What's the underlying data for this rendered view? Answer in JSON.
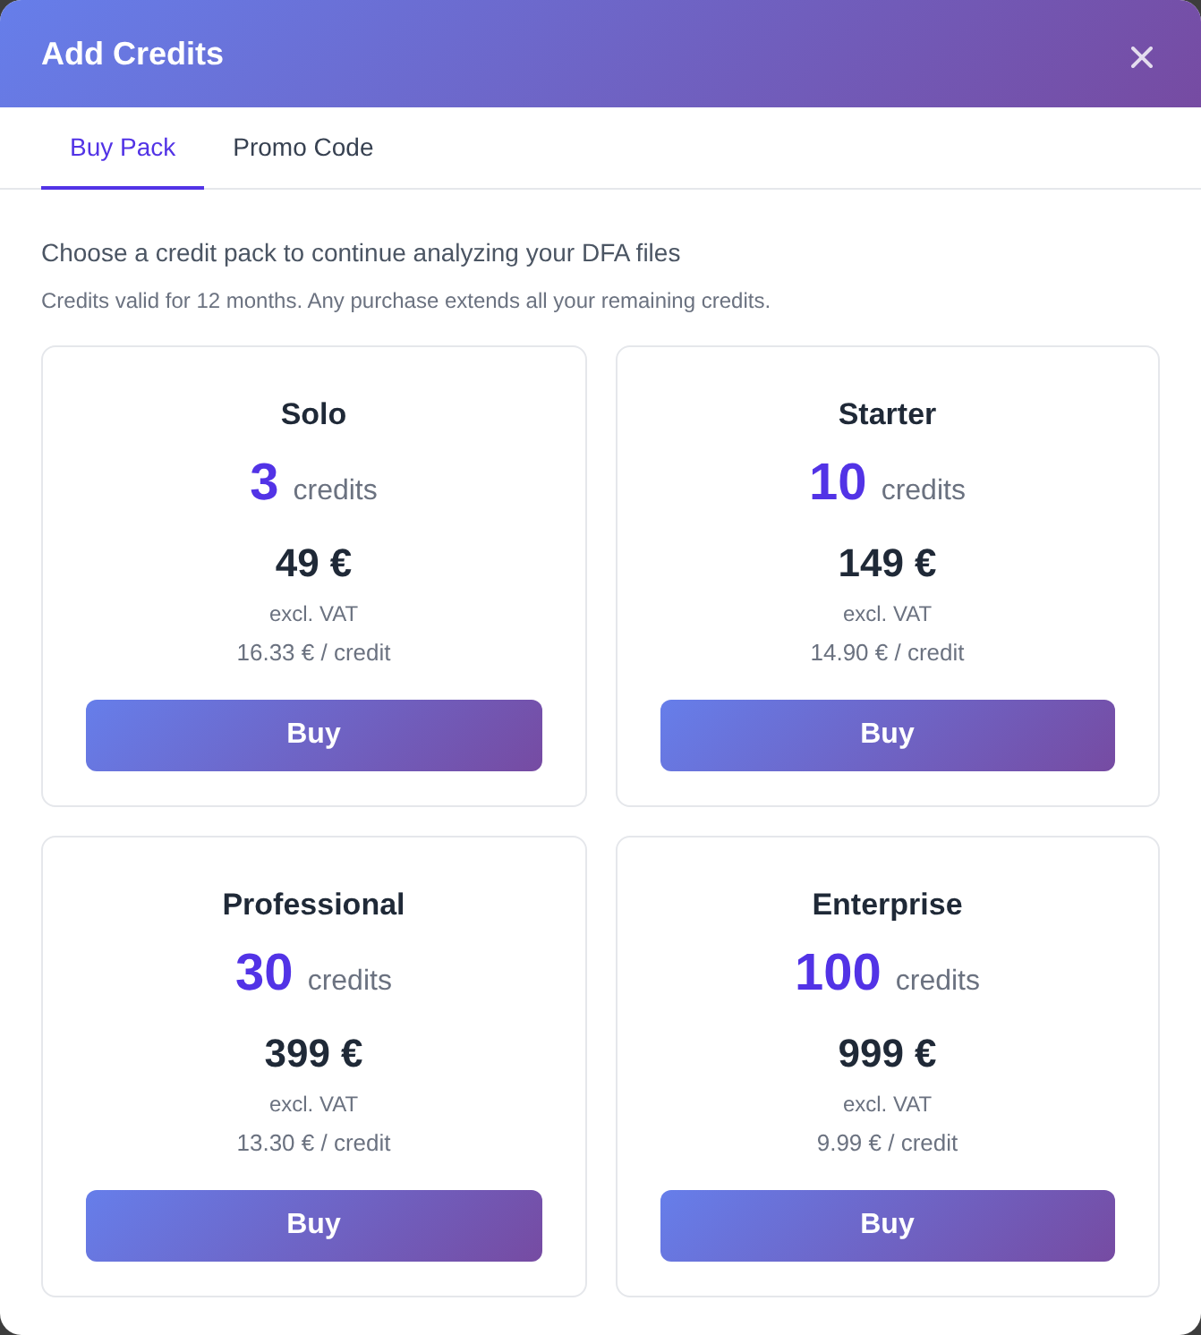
{
  "dialog": {
    "title": "Add Credits"
  },
  "tabs": [
    {
      "label": "Buy Pack",
      "selected": true
    },
    {
      "label": "Promo Code",
      "selected": false
    }
  ],
  "intro": {
    "heading": "Choose a credit pack to continue analyzing your DFA files",
    "note": "Credits valid for 12 months. Any purchase extends all your remaining credits."
  },
  "packs": [
    {
      "name": "Solo",
      "credits": "3",
      "credits_unit": "credits",
      "price": "49 €",
      "tax_note": "excl. VAT",
      "unit_price": "16.33 € / credit",
      "button": "Buy"
    },
    {
      "name": "Starter",
      "credits": "10",
      "credits_unit": "credits",
      "price": "149 €",
      "tax_note": "excl. VAT",
      "unit_price": "14.90 € / credit",
      "button": "Buy"
    },
    {
      "name": "Professional",
      "credits": "30",
      "credits_unit": "credits",
      "price": "399 €",
      "tax_note": "excl. VAT",
      "unit_price": "13.30 € / credit",
      "button": "Buy"
    },
    {
      "name": "Enterprise",
      "credits": "100",
      "credits_unit": "credits",
      "price": "999 €",
      "tax_note": "excl. VAT",
      "unit_price": "9.99 € / credit",
      "button": "Buy"
    }
  ]
}
